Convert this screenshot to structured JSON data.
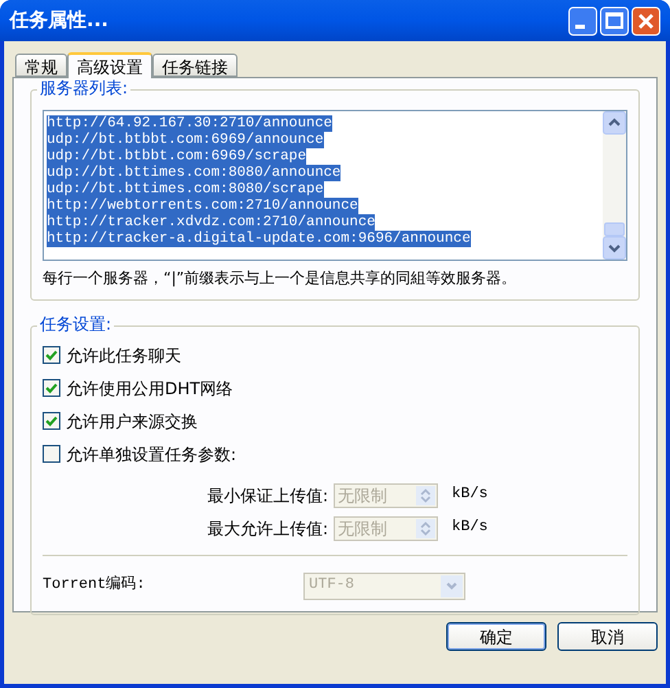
{
  "window": {
    "title": "任务属性..."
  },
  "tabs": [
    {
      "label": "常规",
      "selected": false
    },
    {
      "label": "高级设置",
      "selected": true
    },
    {
      "label": "任务链接",
      "selected": false
    }
  ],
  "server_list": {
    "legend": "服务器列表:",
    "lines": [
      {
        "text": "http://64.92.167.30:2710/announce",
        "selected": true
      },
      {
        "text": "udp://bt.btbbt.com:6969/announce",
        "selected": true
      },
      {
        "text": "udp://bt.btbbt.com:6969/scrape",
        "selected": true
      },
      {
        "text": "udp://bt.bttimes.com:8080/announce",
        "selected": true
      },
      {
        "text": "udp://bt.bttimes.com:8080/scrape",
        "selected": true
      },
      {
        "text": "http://webtorrents.com:2710/announce",
        "selected": true
      },
      {
        "text": "http://tracker.xdvdz.com:2710/announce",
        "selected": true
      },
      {
        "text": "http://tracker-a.digital-update.com:9696/announce",
        "selected": true
      }
    ],
    "hint": "每行一个服务器，“|”前缀表示与上一个是信息共享的同組等效服务器。"
  },
  "task_settings": {
    "legend": "任务设置:",
    "options": [
      {
        "label": "允许此任务聊天",
        "checked": true
      },
      {
        "label": "允许使用公用DHT网络",
        "checked": true
      },
      {
        "label": "允许用户来源交换",
        "checked": true
      },
      {
        "label": "允许单独设置任务参数:",
        "checked": false
      }
    ],
    "upload_limits": [
      {
        "label": "最小保证上传值:",
        "value": "无限制",
        "unit": "kB/s",
        "disabled": true
      },
      {
        "label": "最大允许上传值:",
        "value": "无限制",
        "unit": "kB/s",
        "disabled": true
      }
    ],
    "encoding": {
      "label": "Torrent编码:",
      "value": "UTF-8",
      "disabled": true
    }
  },
  "buttons": [
    {
      "label": "确定",
      "default": true
    },
    {
      "label": "取消",
      "default": false
    }
  ]
}
